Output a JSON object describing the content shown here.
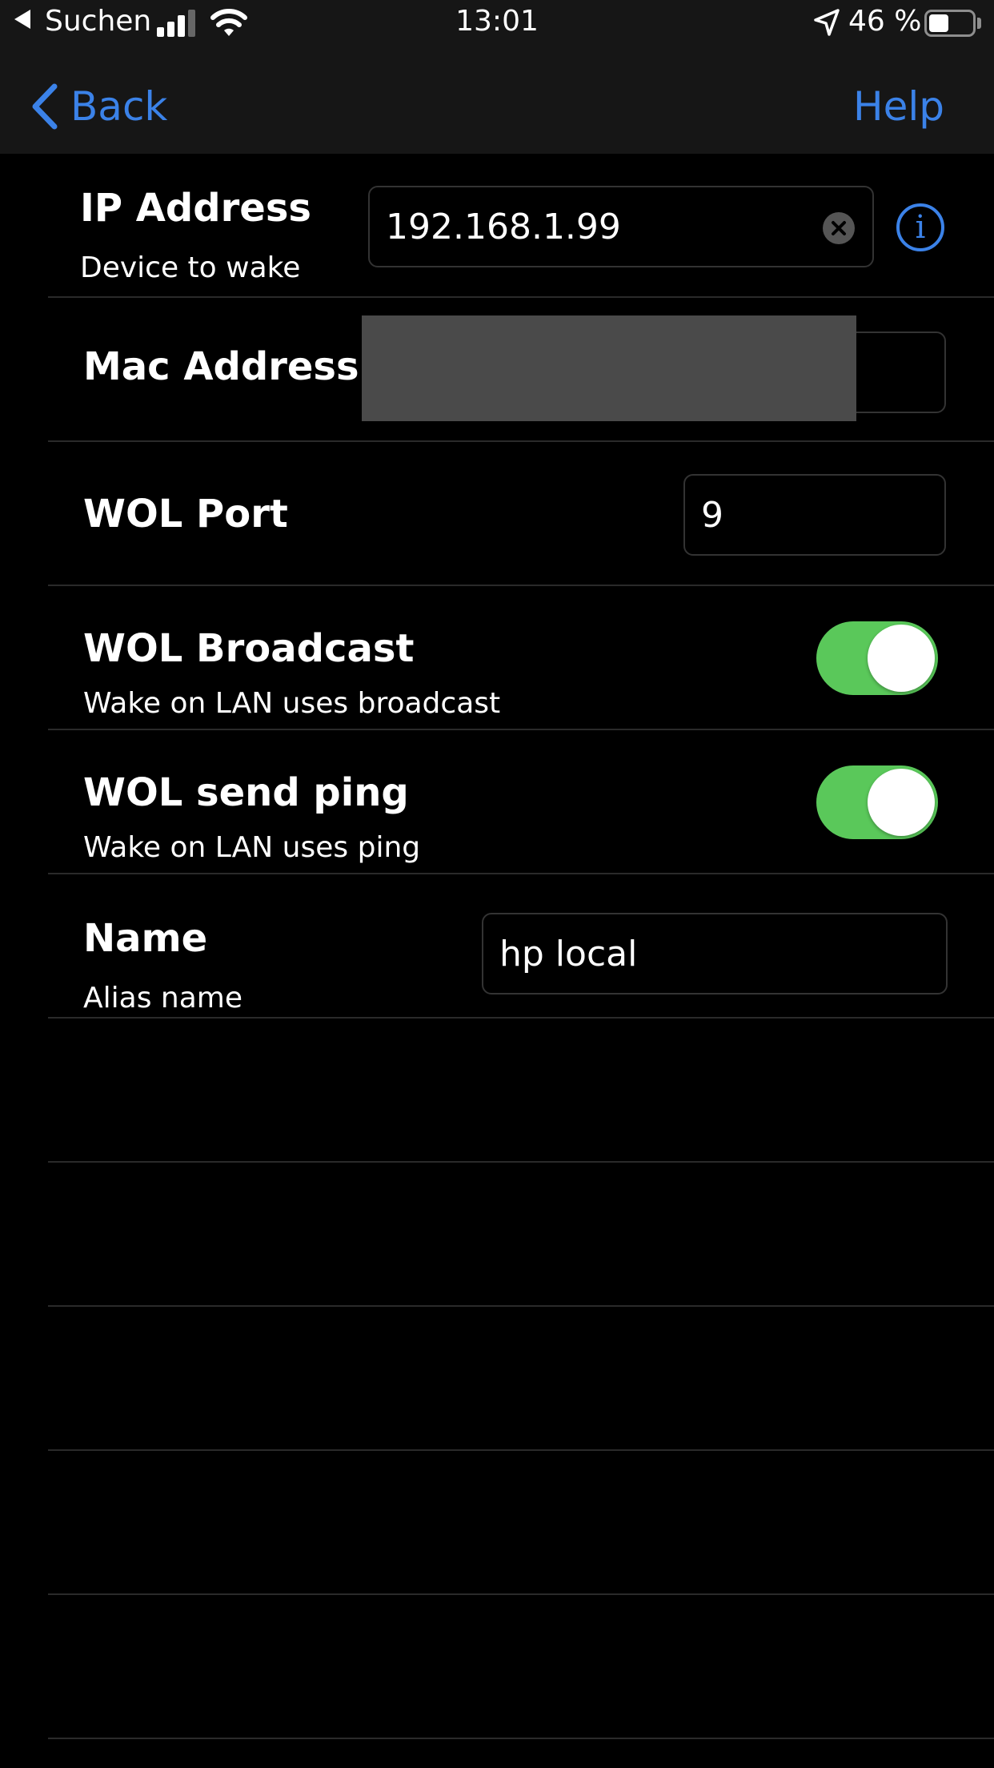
{
  "status_bar": {
    "carrier": "Suchen",
    "time": "13:01",
    "battery_percent": "46 %",
    "battery_level": 0.46,
    "icons": [
      "back-arrow-icon",
      "signal-icon",
      "wifi-icon",
      "location-icon",
      "battery-icon"
    ]
  },
  "nav": {
    "back_label": "Back",
    "help_label": "Help"
  },
  "form": {
    "ip": {
      "title": "IP Address",
      "subtitle": "Device to wake",
      "value": "192.168.1.99"
    },
    "mac": {
      "title": "Mac Address",
      "value": ""
    },
    "port": {
      "title": "WOL Port",
      "value": "9"
    },
    "broadcast": {
      "title": "WOL Broadcast",
      "subtitle": "Wake on LAN uses broadcast",
      "enabled": true
    },
    "ping": {
      "title": "WOL send ping",
      "subtitle": "Wake on LAN uses ping",
      "enabled": true
    },
    "name": {
      "title": "Name",
      "subtitle": "Alias name",
      "value": "hp local"
    }
  },
  "colors": {
    "accent": "#3b82e8",
    "toggle_on": "#5ac85a",
    "bar_background": "#161616",
    "background": "#000000"
  }
}
